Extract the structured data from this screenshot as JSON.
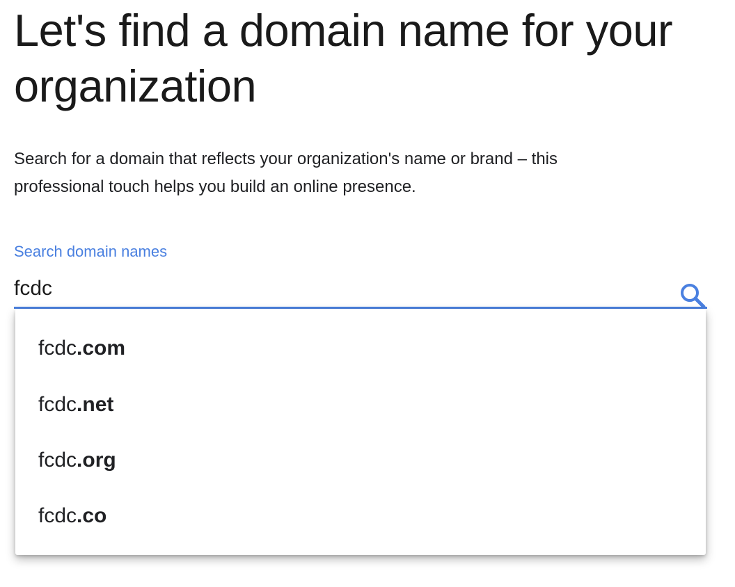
{
  "heading": "Let's find a domain name for your organization",
  "description": "Search for a domain that reflects your organization's name or brand – this professional touch helps you build an online presence.",
  "search": {
    "label": "Search domain names",
    "value": "fcdc",
    "icon": "search-icon",
    "accent_color": "#4a80e0"
  },
  "suggestions": [
    {
      "name": "fcdc",
      "tld": ".com"
    },
    {
      "name": "fcdc",
      "tld": ".net"
    },
    {
      "name": "fcdc",
      "tld": ".org"
    },
    {
      "name": "fcdc",
      "tld": ".co"
    }
  ]
}
